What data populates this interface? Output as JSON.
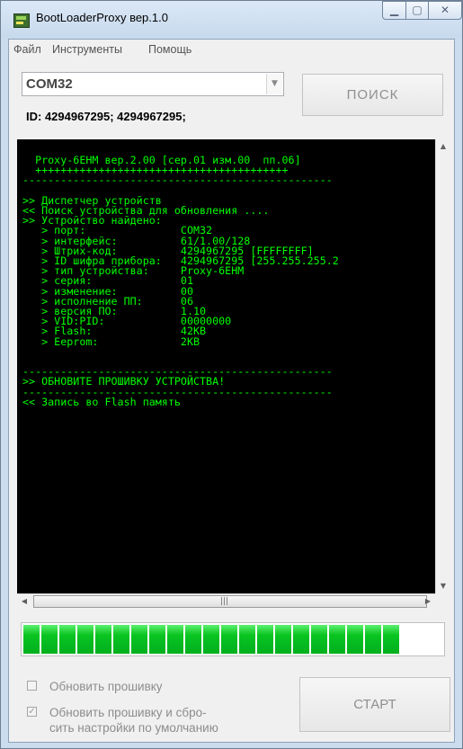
{
  "window": {
    "title": "BootLoaderProxy вер.1.0"
  },
  "menu": [
    "Файл",
    "Инструменты",
    "Помощь"
  ],
  "port_select": {
    "value": "COM32"
  },
  "search_button": "ПОИСК",
  "device_id_line": "ID: 4294967295; 4294967295;",
  "console_lines": [
    "  Proxy-6EHM вер.2.00 [сер.01 изм.00  пп.06]",
    "  ++++++++++++++++++++++++++++++++++++++++",
    "-------------------------------------------------",
    "",
    ">> Диспетчер устройств",
    "<< Поиск устройства для обновления ....",
    ">> Устройство найдено:",
    "   > порт:               COM32",
    "   > интерфейс:          61/1.00/128",
    "   > Штрих-код:          4294967295 [FFFFFFFF]",
    "   > ID шифра прибора:   4294967295 [255.255.255.2",
    "   > тип устройства:     Proxy-6EHM",
    "   > серия:              01",
    "   > изменение:          00",
    "   > исполнение ПП:      06",
    "   > версия ПО:          1.10",
    "   > VID:PID:            00000000",
    "   > Flash:              42KB",
    "   > Eeprom:             2KB",
    "",
    "",
    "-------------------------------------------------",
    ">> ОБНОВИТЕ ПРОШИВКУ УСТРОЙСТВА!",
    "-------------------------------------------------",
    "<< Запись во Flash память"
  ],
  "progress": {
    "filled_segments": 21,
    "fraction": 0.88
  },
  "options": {
    "update_firmware": {
      "label": "Обновить прошивку",
      "checked": false
    },
    "update_and_reset": {
      "label_line1": "Обновить прошивку и сбро-",
      "label_line2": "сить настройки по умолчанию",
      "checked": true
    }
  },
  "start_button": "СТАРТ",
  "colors": {
    "console_bg": "#000000",
    "console_text": "#00ff00",
    "progress": "#06b025"
  }
}
